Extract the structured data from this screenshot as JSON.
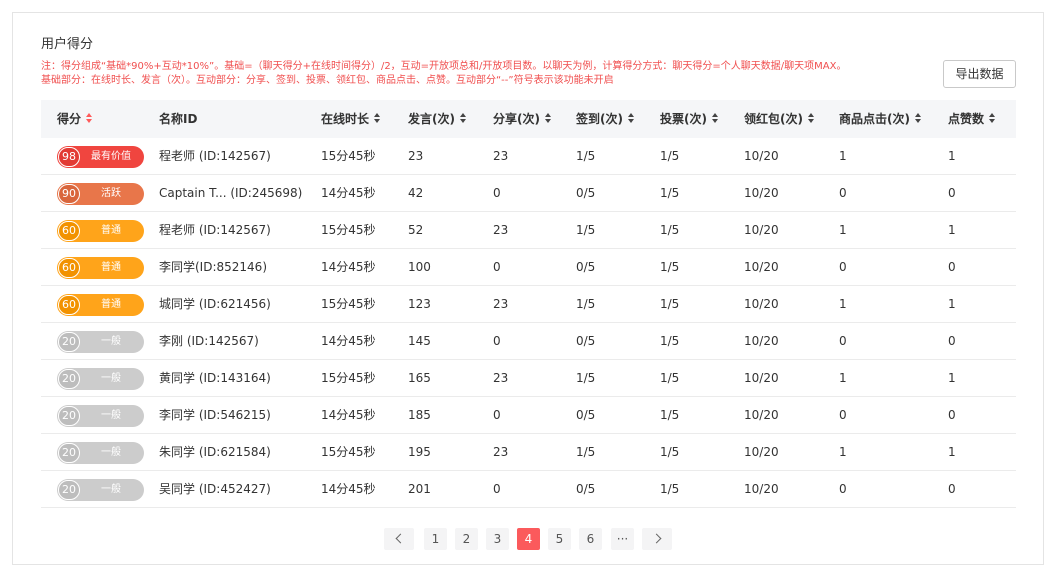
{
  "page": {
    "title": "用户得分",
    "note_line1": "注：得分组成“基础*90%+互动*10%”。基础=（聊天得分+在线时间得分）/2，互动=开放项总和/开放项目数。以聊天为例，计算得分方式：聊天得分=个人聊天数据/聊天项MAX。",
    "note_line2": "基础部分：在线时长、发言（次）。互动部分：分享、签到、投票、领红包、商品点击、点赞。互动部分“--”符号表示该功能未开启",
    "export_label": "导出数据"
  },
  "colors": {
    "note": "#f04f4f",
    "active_sort": "#ff5a5a",
    "pager_active": "#fb5a5c",
    "tier_best": "#f0453f",
    "tier_active": "#e8764a",
    "tier_normal": "#ffa41a",
    "tier_general": "#cccccc"
  },
  "table": {
    "headers": [
      "得分",
      "名称ID",
      "在线时长",
      "发言(次)",
      "分享(次)",
      "签到(次)",
      "投票(次)",
      "领红包(次)",
      "商品点击(次)",
      "点赞数"
    ],
    "rows": [
      {
        "score": "98",
        "tier": "最有价值",
        "tier_key": "best",
        "name": "程老师 (ID:142567)",
        "online": "15分45秒",
        "speak": "23",
        "share": "23",
        "checkin": "1/5",
        "vote": "1/5",
        "redpack": "10/20",
        "click": "1",
        "like": "1"
      },
      {
        "score": "90",
        "tier": "活跃",
        "tier_key": "active",
        "name": "Captain  T... (ID:245698)",
        "online": "14分45秒",
        "speak": "42",
        "share": "0",
        "checkin": "0/5",
        "vote": "1/5",
        "redpack": "10/20",
        "click": "0",
        "like": "0"
      },
      {
        "score": "60",
        "tier": "普通",
        "tier_key": "normal",
        "name": "程老师 (ID:142567)",
        "online": "15分45秒",
        "speak": "52",
        "share": "23",
        "checkin": "1/5",
        "vote": "1/5",
        "redpack": "10/20",
        "click": "1",
        "like": "1"
      },
      {
        "score": "60",
        "tier": "普通",
        "tier_key": "normal",
        "name": "李同学(ID:852146)",
        "online": "14分45秒",
        "speak": "100",
        "share": "0",
        "checkin": "0/5",
        "vote": "1/5",
        "redpack": "10/20",
        "click": "0",
        "like": "0"
      },
      {
        "score": "60",
        "tier": "普通",
        "tier_key": "normal",
        "name": "城同学 (ID:621456)",
        "online": "15分45秒",
        "speak": "123",
        "share": "23",
        "checkin": "1/5",
        "vote": "1/5",
        "redpack": "10/20",
        "click": "1",
        "like": "1"
      },
      {
        "score": "20",
        "tier": "一般",
        "tier_key": "general",
        "name": "李刚 (ID:142567)",
        "online": "14分45秒",
        "speak": "145",
        "share": "0",
        "checkin": "0/5",
        "vote": "1/5",
        "redpack": "10/20",
        "click": "0",
        "like": "0"
      },
      {
        "score": "20",
        "tier": "一般",
        "tier_key": "general",
        "name": "黄同学 (ID:143164)",
        "online": "15分45秒",
        "speak": "165",
        "share": "23",
        "checkin": "1/5",
        "vote": "1/5",
        "redpack": "10/20",
        "click": "1",
        "like": "1"
      },
      {
        "score": "20",
        "tier": "一般",
        "tier_key": "general",
        "name": "李同学 (ID:546215)",
        "online": "14分45秒",
        "speak": "185",
        "share": "0",
        "checkin": "0/5",
        "vote": "1/5",
        "redpack": "10/20",
        "click": "0",
        "like": "0"
      },
      {
        "score": "20",
        "tier": "一般",
        "tier_key": "general",
        "name": "朱同学 (ID:621584)",
        "online": "15分45秒",
        "speak": "195",
        "share": "23",
        "checkin": "1/5",
        "vote": "1/5",
        "redpack": "10/20",
        "click": "1",
        "like": "1"
      },
      {
        "score": "20",
        "tier": "一般",
        "tier_key": "general",
        "name": "吴同学 (ID:452427)",
        "online": "14分45秒",
        "speak": "201",
        "share": "0",
        "checkin": "0/5",
        "vote": "1/5",
        "redpack": "10/20",
        "click": "0",
        "like": "0"
      }
    ]
  },
  "pagination": {
    "pages": [
      "1",
      "2",
      "3",
      "4",
      "5",
      "6"
    ],
    "current": "4",
    "ellipsis": "···",
    "prev_icon": "chevron-left-icon",
    "next_icon": "chevron-right-icon"
  }
}
